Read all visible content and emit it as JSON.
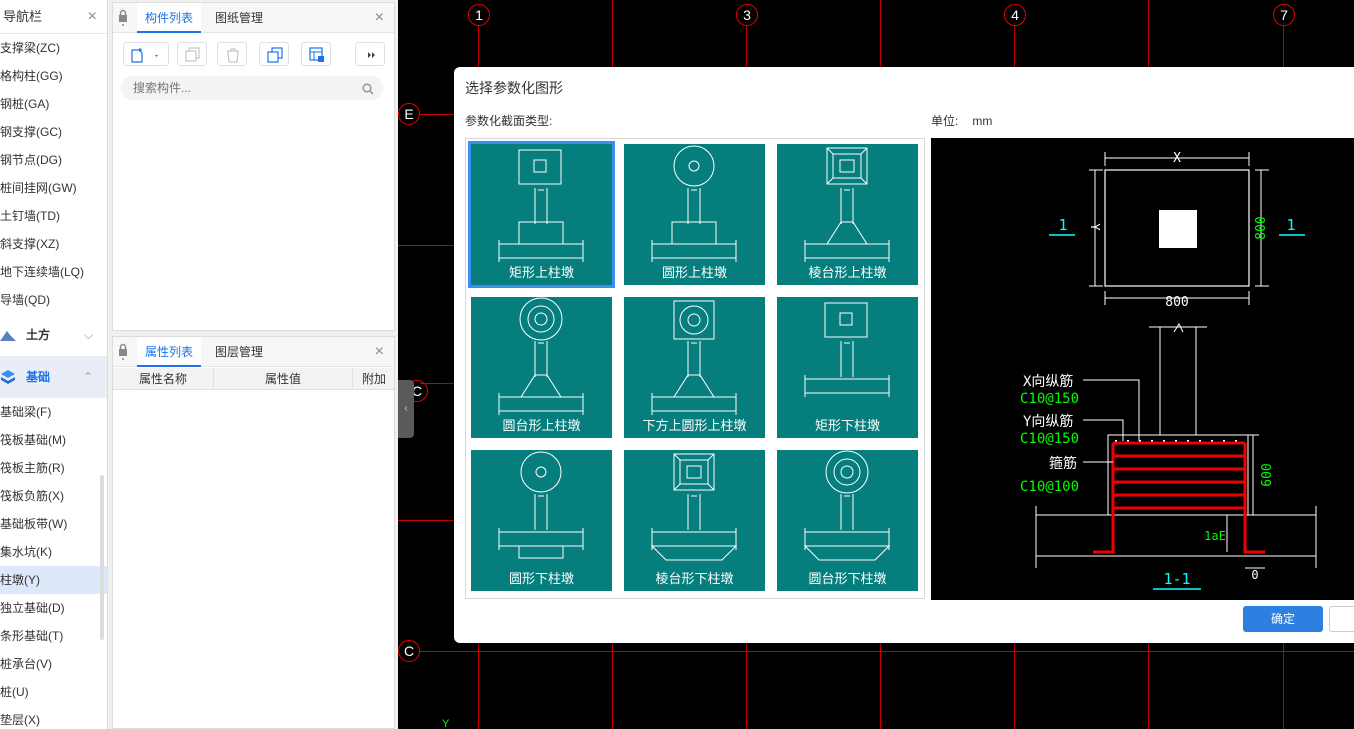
{
  "nav": {
    "title": "导航栏",
    "close": "×",
    "items_top": [
      "支撑梁(ZC)",
      "格构柱(GG)",
      "钢桩(GA)",
      "钢支撑(GC)",
      "钢节点(DG)",
      "桩间挂网(GW)",
      "土钉墙(TD)",
      "斜支撑(XZ)",
      "地下连续墙(LQ)",
      "导墙(QD)"
    ],
    "group_earth": "土方",
    "group_foundation": "基础",
    "items_foundation": [
      "基础梁(F)",
      "筏板基础(M)",
      "筏板主筋(R)",
      "筏板负筋(X)",
      "基础板带(W)",
      "集水坑(K)",
      "柱墩(Y)",
      "独立基础(D)",
      "条形基础(T)",
      "桩承台(V)",
      "桩(U)",
      "垫层(X)"
    ],
    "active_item": "柱墩(Y)"
  },
  "component_panel": {
    "tab_active": "构件列表",
    "tab_other": "图纸管理",
    "close": "×",
    "search_placeholder": "搜索构件..."
  },
  "property_panel": {
    "tab_active": "属性列表",
    "tab_other": "图层管理",
    "close": "×",
    "columns": [
      "属性名称",
      "属性值",
      "附加"
    ]
  },
  "canvas": {
    "axis_top": [
      "1",
      "3",
      "4",
      "7"
    ],
    "axis_left": [
      "E",
      "C",
      "C"
    ],
    "y_mark": "Y"
  },
  "dialog": {
    "title": "选择参数化图形",
    "type_label": "参数化截面类型:",
    "unit_label": "单位:",
    "unit_value": "mm",
    "shapes": [
      "矩形上柱墩",
      "圆形上柱墩",
      "棱台形上柱墩",
      "圆台形上柱墩",
      "下方上圆形上柱墩",
      "矩形下柱墩",
      "圆形下柱墩",
      "棱台形下柱墩",
      "圆台形下柱墩"
    ],
    "selected_shape": "矩形上柱墩",
    "ok_label": "确定",
    "preview": {
      "dim_x": "X",
      "dim_y": "Y",
      "dim_800_h": "800",
      "dim_800_v": "800",
      "section_mark": "1",
      "x_rebar_label": "X向纵筋",
      "x_rebar_value": "C10@150",
      "y_rebar_label": "Y向纵筋",
      "y_rebar_value": "C10@150",
      "stirrup_label": "箍筋",
      "stirrup_value": "C10@100",
      "dim_600": "600",
      "lae": "1aE",
      "dim_0": "0",
      "section_title": "1-1"
    }
  },
  "colors": {
    "accent": "#1a73e8",
    "shape_bg": "#067e7e",
    "axis_red": "#cc0000"
  }
}
